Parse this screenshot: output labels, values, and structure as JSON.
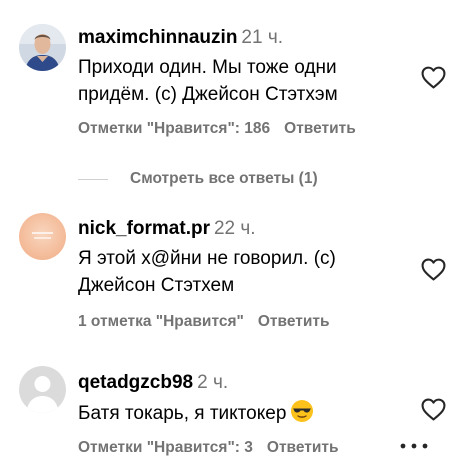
{
  "comments": [
    {
      "username": "maximchinnauzin",
      "time": "21 ч.",
      "text_line1": "Приходи один. Мы тоже одни",
      "text_line2": "придём. (с) Джейсон Стэтхэм",
      "likes": "Отметки \"Нравится\": 186",
      "reply": "Ответить"
    },
    {
      "username": "nick_format.pr",
      "time": "22 ч.",
      "text_line1": "Я этой х@йни не говорил. (с)",
      "text_line2": "Джейсон Стэтхем",
      "likes": "1 отметка \"Нравится\"",
      "reply": "Ответить"
    },
    {
      "username": "qetadgzcb98",
      "time": "2 ч.",
      "text_line1": "Батя токарь, я тиктокер",
      "likes": "Отметки \"Нравится\": 3",
      "reply": "Ответить"
    }
  ],
  "view_replies": "Смотреть все ответы (1)",
  "icons": {
    "like": "heart-outline-icon",
    "emoji": "sunglasses-emoji",
    "more": "more-options-icon"
  },
  "colors": {
    "secondary_text": "#737373",
    "primary_text": "#000000"
  }
}
